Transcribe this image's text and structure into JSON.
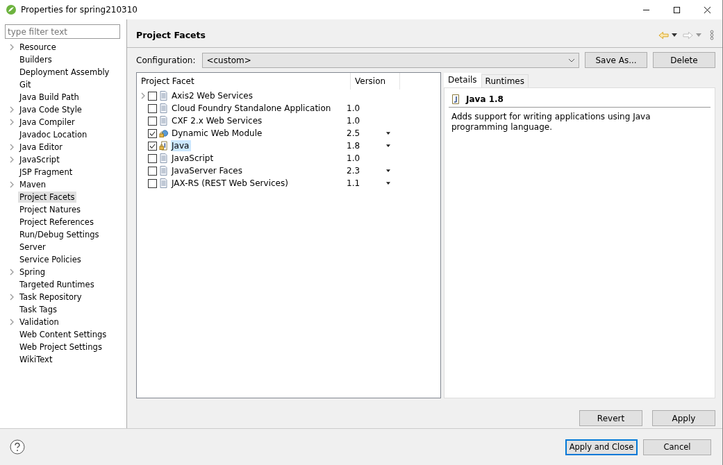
{
  "window": {
    "title": "Properties for spring210310"
  },
  "filter": {
    "placeholder": "type filter text"
  },
  "sidebar": {
    "items": [
      {
        "label": "Resource",
        "expandable": true,
        "selected": false
      },
      {
        "label": "Builders",
        "expandable": false,
        "selected": false
      },
      {
        "label": "Deployment Assembly",
        "expandable": false,
        "selected": false
      },
      {
        "label": "Git",
        "expandable": false,
        "selected": false
      },
      {
        "label": "Java Build Path",
        "expandable": false,
        "selected": false
      },
      {
        "label": "Java Code Style",
        "expandable": true,
        "selected": false
      },
      {
        "label": "Java Compiler",
        "expandable": true,
        "selected": false
      },
      {
        "label": "Javadoc Location",
        "expandable": false,
        "selected": false
      },
      {
        "label": "Java Editor",
        "expandable": true,
        "selected": false
      },
      {
        "label": "JavaScript",
        "expandable": true,
        "selected": false
      },
      {
        "label": "JSP Fragment",
        "expandable": false,
        "selected": false
      },
      {
        "label": "Maven",
        "expandable": true,
        "selected": false
      },
      {
        "label": "Project Facets",
        "expandable": false,
        "selected": true
      },
      {
        "label": "Project Natures",
        "expandable": false,
        "selected": false
      },
      {
        "label": "Project References",
        "expandable": false,
        "selected": false
      },
      {
        "label": "Run/Debug Settings",
        "expandable": false,
        "selected": false
      },
      {
        "label": "Server",
        "expandable": false,
        "selected": false
      },
      {
        "label": "Service Policies",
        "expandable": false,
        "selected": false
      },
      {
        "label": "Spring",
        "expandable": true,
        "selected": false
      },
      {
        "label": "Targeted Runtimes",
        "expandable": false,
        "selected": false
      },
      {
        "label": "Task Repository",
        "expandable": true,
        "selected": false
      },
      {
        "label": "Task Tags",
        "expandable": false,
        "selected": false
      },
      {
        "label": "Validation",
        "expandable": true,
        "selected": false
      },
      {
        "label": "Web Content Settings",
        "expandable": false,
        "selected": false
      },
      {
        "label": "Web Project Settings",
        "expandable": false,
        "selected": false
      },
      {
        "label": "WikiText",
        "expandable": false,
        "selected": false
      }
    ]
  },
  "page": {
    "title": "Project Facets",
    "configuration_label": "Configuration:",
    "configuration_value": "<custom>",
    "buttons": [
      "Save As...",
      "Delete"
    ]
  },
  "facets": {
    "columns": [
      "Project Facet",
      "Version"
    ],
    "rows": [
      {
        "name": "Axis2 Web Services",
        "kind": "doc",
        "expandable": true,
        "checked": false,
        "selected": false,
        "dropdown": false
      },
      {
        "name": "Cloud Foundry Standalone Application",
        "version": "1.0",
        "kind": "doc",
        "expandable": false,
        "checked": false,
        "selected": false,
        "dropdown": false
      },
      {
        "name": "CXF 2.x Web Services",
        "version": "1.0",
        "kind": "doc",
        "expandable": false,
        "checked": false,
        "selected": false,
        "dropdown": false
      },
      {
        "name": "Dynamic Web Module",
        "version": "2.5",
        "kind": "web",
        "expandable": false,
        "checked": true,
        "selected": false,
        "dropdown": true
      },
      {
        "name": "Java",
        "version": "1.8",
        "kind": "java",
        "expandable": false,
        "checked": true,
        "selected": true,
        "dropdown": true
      },
      {
        "name": "JavaScript",
        "version": "1.0",
        "kind": "doc",
        "expandable": false,
        "checked": false,
        "selected": false,
        "dropdown": false
      },
      {
        "name": "JavaServer Faces",
        "version": "2.3",
        "kind": "doc",
        "expandable": false,
        "checked": false,
        "selected": false,
        "dropdown": true
      },
      {
        "name": "JAX-RS (REST Web Services)",
        "version": "1.1",
        "kind": "doc",
        "expandable": false,
        "checked": false,
        "selected": false,
        "dropdown": true
      }
    ]
  },
  "details": {
    "tabs": [
      {
        "label": "Details",
        "selected": true
      },
      {
        "label": "Runtimes",
        "selected": false
      }
    ],
    "heading": "Java 1.8",
    "description": "Adds support for writing applications using Java programming language."
  },
  "page_buttons": [
    "Revert",
    "Apply"
  ],
  "dialog_buttons": [
    {
      "label": "Apply and Close",
      "default": true
    },
    {
      "label": "Cancel",
      "default": false
    }
  ]
}
